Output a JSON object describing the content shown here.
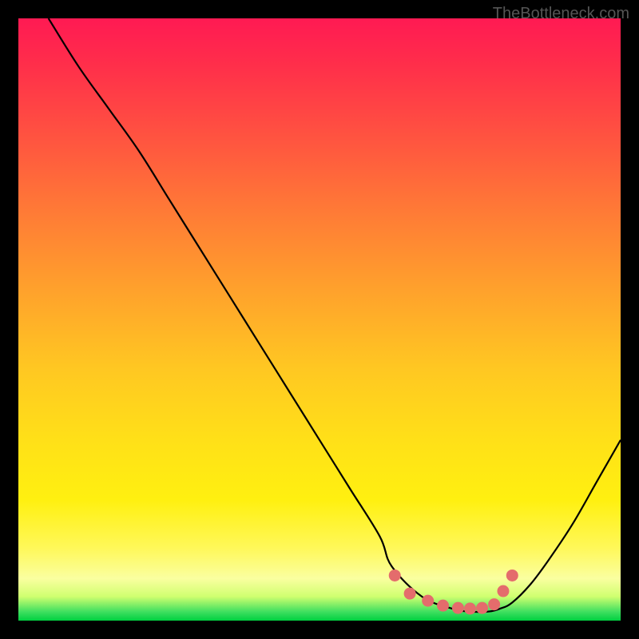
{
  "attribution": "TheBottleneck.com",
  "chart_data": {
    "type": "line",
    "title": "",
    "xlabel": "",
    "ylabel": "",
    "xlim": [
      0,
      100
    ],
    "ylim": [
      0,
      100
    ],
    "series": [
      {
        "name": "bottleneck-curve",
        "x": [
          5,
          10,
          15,
          20,
          25,
          30,
          35,
          40,
          45,
          50,
          55,
          60,
          62,
          67,
          72,
          75,
          78,
          80,
          82,
          85,
          88,
          92,
          96,
          100
        ],
        "values": [
          100,
          92,
          85,
          78,
          70,
          62,
          54,
          46,
          38,
          30,
          22,
          14,
          9,
          4,
          2,
          1.5,
          1.5,
          2,
          3,
          6,
          10,
          16,
          23,
          30
        ]
      }
    ],
    "markers": {
      "name": "highlight-dots",
      "color": "#e46c6c",
      "points": [
        {
          "x": 62.5,
          "y": 7.5
        },
        {
          "x": 65,
          "y": 4.5
        },
        {
          "x": 68,
          "y": 3.3
        },
        {
          "x": 70.5,
          "y": 2.5
        },
        {
          "x": 73,
          "y": 2.1
        },
        {
          "x": 75,
          "y": 2.0
        },
        {
          "x": 77,
          "y": 2.1
        },
        {
          "x": 79,
          "y": 2.7
        },
        {
          "x": 80.5,
          "y": 4.9
        },
        {
          "x": 82,
          "y": 7.5
        }
      ]
    },
    "background_gradient": {
      "stops": [
        {
          "pos": 0.0,
          "color": "#ff1a53"
        },
        {
          "pos": 0.5,
          "color": "#ffc722"
        },
        {
          "pos": 0.93,
          "color": "#faffa0"
        },
        {
          "pos": 1.0,
          "color": "#00d040"
        }
      ]
    }
  }
}
